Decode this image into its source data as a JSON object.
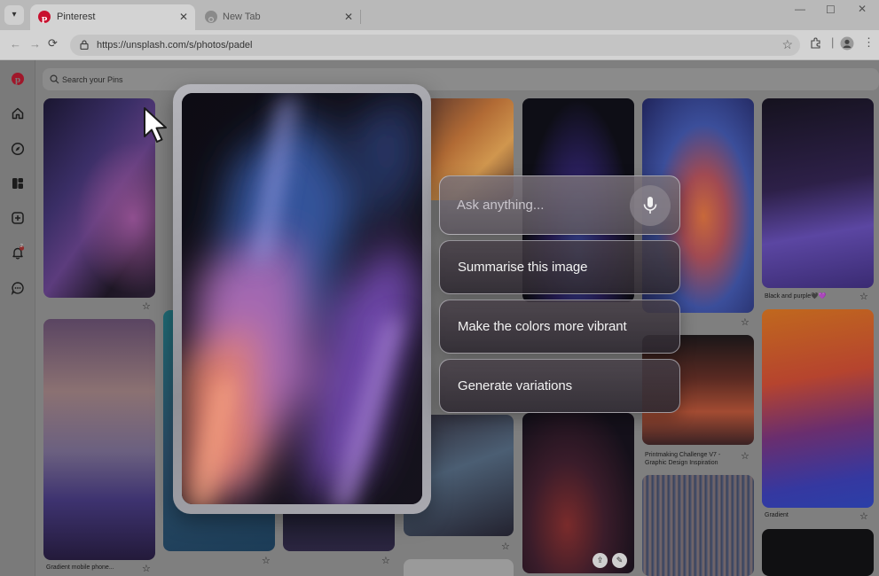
{
  "browser": {
    "tabs": [
      {
        "title": "Pinterest",
        "active": true
      },
      {
        "title": "New Tab",
        "active": false
      }
    ],
    "url": "https://unsplash.com/s/photos/padel"
  },
  "pinterest": {
    "search_placeholder": "Search your Pins",
    "captions": {
      "black_purple": "Black and purple🖤💜",
      "printmaking": "Printmaking Challenge V7 -",
      "printmaking2": "Graphic Design Inspiration",
      "gradient": "Gradient",
      "gradient_mobile": "Gradient mobile phone..."
    },
    "notification_count": "2"
  },
  "assistant": {
    "ask_placeholder": "Ask anything...",
    "suggestions": [
      "Summarise this image",
      "Make the colors more vibrant",
      "Generate variations"
    ]
  },
  "colors": {
    "pinterest_red": "#e60023",
    "glass_border": "#e6e6eb"
  }
}
